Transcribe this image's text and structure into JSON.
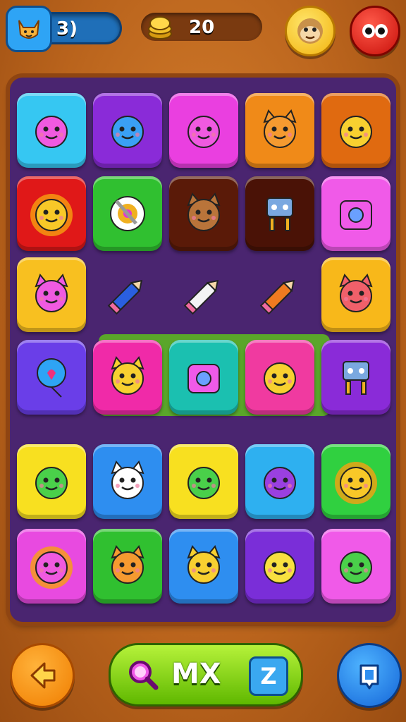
{
  "hud": {
    "lives": "3)",
    "coins": "20"
  },
  "word_bar": {
    "text": "MX",
    "z_label": "Z"
  },
  "icons": {
    "lives_badge": "cat-face-icon",
    "coins": "coin-stack-icon",
    "avatar": "monkey-face-icon",
    "menu": "eyes-icon",
    "back": "back-arrow-icon",
    "search": "magnifier-icon",
    "stop": "square-icon"
  },
  "tiles": [
    [
      {
        "color": "#36c7f2",
        "icon": "pink-fish"
      },
      {
        "color": "#8a2bd8",
        "icon": "blue-fish"
      },
      {
        "color": "#ea3fe0",
        "icon": "pink-monster"
      },
      {
        "color": "#f08a18",
        "icon": "orange-bear"
      },
      {
        "color": "#e06a10",
        "icon": "yellow-bird"
      }
    ],
    [
      {
        "color": "#e01818",
        "icon": "sun-face"
      },
      {
        "color": "#30c030",
        "icon": "target"
      },
      {
        "color": "#5a1a08",
        "icon": "brown-bear"
      },
      {
        "color": "#4a1206",
        "icon": "key-tool"
      },
      {
        "color": "#f05ae8",
        "icon": "heart-gadget"
      }
    ],
    [
      {
        "color": "#f8c020",
        "icon": "pink-cat"
      },
      {
        "color": "#5aa62a",
        "icon": "blue-pencil"
      },
      {
        "color": "#5aa62a",
        "icon": "white-pencil"
      },
      {
        "color": "#5aa62a",
        "icon": "orange-pencil"
      },
      {
        "color": "#f8b81a",
        "icon": "red-cat"
      }
    ],
    [
      {
        "color": "#6a3ee8",
        "icon": "heart-balloon"
      },
      {
        "color": "#f02aa8",
        "icon": "yellow-bear-legs"
      },
      {
        "color": "#1bc0b0",
        "icon": "pink-bag"
      },
      {
        "color": "#f03aa0",
        "icon": "yellow-face"
      },
      {
        "color": "#8a2bd8",
        "icon": "robot"
      }
    ],
    [
      {
        "color": "#f8e020",
        "icon": "green-dino"
      },
      {
        "color": "#2e8ef0",
        "icon": "white-cat"
      },
      {
        "color": "#f8e020",
        "icon": "green-ball"
      },
      {
        "color": "#2eb0f0",
        "icon": "purple-ball"
      },
      {
        "color": "#30d040",
        "icon": "sun-face-2"
      }
    ],
    [
      {
        "color": "#e84ae0",
        "icon": "pink-sun"
      },
      {
        "color": "#30c030",
        "icon": "orange-lion"
      },
      {
        "color": "#2e8ef0",
        "icon": "yellow-bear"
      },
      {
        "color": "#7a2ed8",
        "icon": "lemon-face"
      },
      {
        "color": "#f05ae8",
        "icon": "green-bird"
      }
    ]
  ]
}
